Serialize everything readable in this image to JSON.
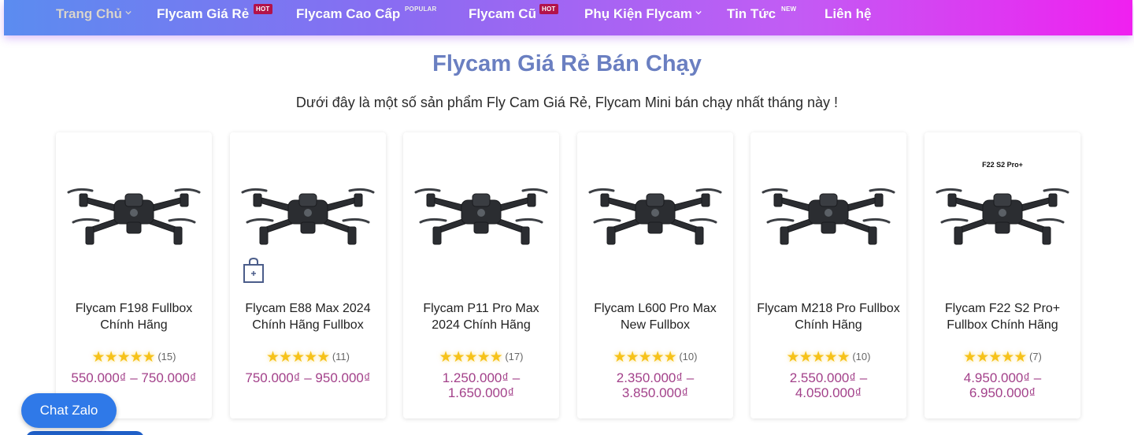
{
  "nav": {
    "items": [
      {
        "label": "Trang Chủ",
        "badge": ""
      },
      {
        "label": "Flycam Giá Rẻ",
        "badge": "HOT"
      },
      {
        "label": "Flycam Cao Cấp",
        "badge": "POPULAR"
      },
      {
        "label": "Flycam Cũ",
        "badge": "HOT"
      },
      {
        "label": "Phụ Kiện Flycam",
        "badge": ""
      },
      {
        "label": "Tin Tức",
        "badge": "NEW"
      },
      {
        "label": "Liên hệ",
        "badge": ""
      }
    ]
  },
  "section": {
    "title": "Flycam Giá Rẻ Bán Chạy",
    "subtitle": "Dưới đây là một số sản phẩm Fly Cam Giá Rẻ, Flycam Mini bán chạy nhất tháng này !"
  },
  "products": [
    {
      "name": "Flycam F198 Fullbox Chính Hãng",
      "stars": "★★★★★",
      "reviews": "(15)",
      "price": "550.000₫ – 750.000₫",
      "caption": ""
    },
    {
      "name": "Flycam E88 Max 2024 Chính Hãng Fullbox",
      "stars": "★★★★★",
      "reviews": "(11)",
      "price": "750.000₫ – 950.000₫",
      "caption": ""
    },
    {
      "name": "Flycam P11 Pro Max 2024 Chính Hãng",
      "stars": "★★★★★",
      "reviews": "(17)",
      "price": "1.250.000₫ – 1.650.000₫",
      "caption": ""
    },
    {
      "name": "Flycam L600 Pro Max New Fullbox",
      "stars": "★★★★★",
      "reviews": "(10)",
      "price": "2.350.000₫ – 3.850.000₫",
      "caption": ""
    },
    {
      "name": "Flycam M218 Pro Fullbox Chính Hãng",
      "stars": "★★★★★",
      "reviews": "(10)",
      "price": "2.550.000₫ – 4.050.000₫",
      "caption": ""
    },
    {
      "name": "Flycam F22 S2 Pro+ Fullbox Chính Hãng",
      "stars": "★★★★★",
      "reviews": "(7)",
      "price": "4.950.000₫ – 6.950.000₫",
      "caption": "F22 S2 Pro+"
    }
  ],
  "chat": {
    "label": "Chat Zalo"
  },
  "icons": {
    "nav_chevron": "chevron-down-icon",
    "cart": "shopping-bag-icon",
    "drone": "drone-image"
  },
  "colors": {
    "title": "#6a7fc1",
    "price": "#a3418a",
    "star": "#f6c21a",
    "hot_badge": "#b3124a",
    "chat": "#2f79e8"
  }
}
